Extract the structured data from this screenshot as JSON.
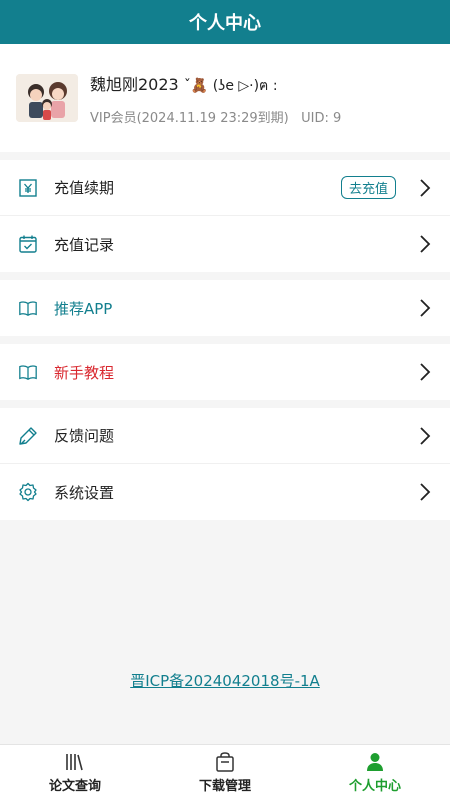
{
  "header": {
    "title": "个人中心"
  },
  "profile": {
    "name": "魏旭刚2023",
    "name_decor": "ˇ🧸 (ʖe ▷·)ฅ :",
    "membership": "VIP会员(2024.11.19 23:29到期)",
    "uid": "UID: 9"
  },
  "menu": {
    "recharge_renew": {
      "label": "充值续期",
      "badge": "去充值"
    },
    "recharge_record": {
      "label": "充值记录"
    },
    "recommend_app": {
      "label": "推荐APP"
    },
    "tutorial": {
      "label": "新手教程"
    },
    "feedback": {
      "label": "反馈问题"
    },
    "settings": {
      "label": "系统设置"
    }
  },
  "footer": {
    "icp": "晋ICP备2024042018号-1A"
  },
  "tabs": [
    {
      "label": "论文查询",
      "icon": "books-icon"
    },
    {
      "label": "下载管理",
      "icon": "bag-icon"
    },
    {
      "label": "个人中心",
      "icon": "person-icon",
      "active": true
    }
  ],
  "colors": {
    "primary": "#127f8e",
    "accent_red": "#d9282f",
    "active_tab": "#1e9e2f"
  }
}
